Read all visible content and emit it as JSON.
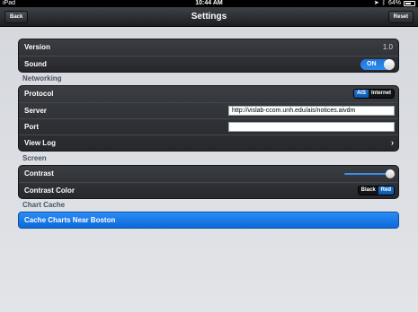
{
  "status_bar": {
    "device": "iPad",
    "time": "10:44 AM",
    "battery": "64%",
    "battery_level": 0.64
  },
  "nav": {
    "title": "Settings",
    "back_label": "Back",
    "reset_label": "Reset"
  },
  "general": {
    "version_label": "Version",
    "version_value": "1.0",
    "sound_label": "Sound",
    "sound_state": "ON"
  },
  "networking": {
    "section_title": "Networking",
    "protocol_label": "Protocol",
    "protocol_options": [
      "AIS",
      "Internet"
    ],
    "protocol_selected": "AIS",
    "server_label": "Server",
    "server_value": "http://vislab-ccom.unh.edu/ais/notices.aivdm",
    "port_label": "Port",
    "port_value": "",
    "view_log_label": "View Log"
  },
  "screen": {
    "section_title": "Screen",
    "contrast_label": "Contrast",
    "contrast_level": 1.0,
    "contrast_color_label": "Contrast Color",
    "color_options": [
      "Black",
      "Red"
    ],
    "color_selected": "Red"
  },
  "chart_cache": {
    "section_title": "Chart Cache",
    "button_label": "Cache Charts Near Boston"
  },
  "colors": {
    "accent": "#1f76d8",
    "nav_bg": "#2a2d31"
  }
}
